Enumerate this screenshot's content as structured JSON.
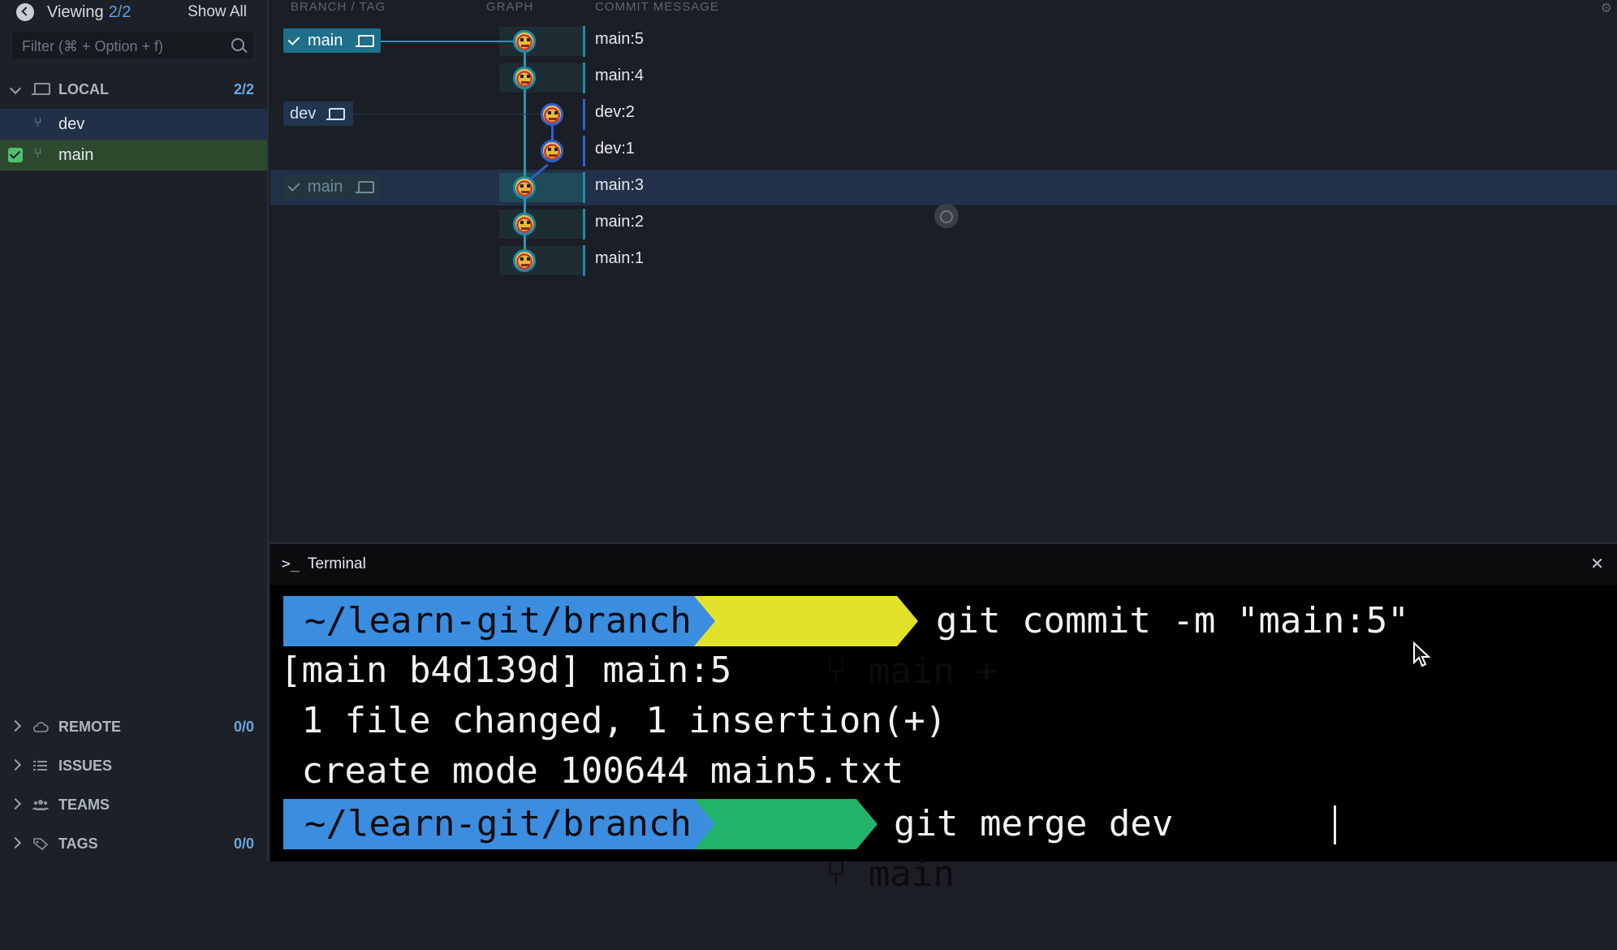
{
  "sidebar": {
    "viewing_label": "Viewing",
    "viewing_count": "2/2",
    "show_all": "Show All",
    "filter_placeholder": "Filter (⌘ + Option + f)",
    "local": {
      "label": "LOCAL",
      "count": "2/2"
    },
    "branches": [
      {
        "label": "dev",
        "checked": false
      },
      {
        "label": "main",
        "checked": true
      }
    ],
    "remote": {
      "label": "REMOTE",
      "count": "0/0"
    },
    "issues": {
      "label": "ISSUES"
    },
    "teams": {
      "label": "TEAMS"
    },
    "tags": {
      "label": "TAGS",
      "count": "0/0"
    }
  },
  "graph": {
    "col_branch": "BRANCH / TAG",
    "col_graph": "GRAPH",
    "col_message": "COMMIT MESSAGE",
    "settings_icon": "gear-icon",
    "tags": [
      {
        "label": "main",
        "row": 0,
        "checked": true,
        "style": "active"
      },
      {
        "label": "dev",
        "row": 2,
        "checked": false,
        "style": "branch"
      },
      {
        "label": "main",
        "row": 4,
        "checked": true,
        "style": "ghost"
      }
    ],
    "commits": [
      {
        "message": "main:5",
        "lane": "main"
      },
      {
        "message": "main:4",
        "lane": "main"
      },
      {
        "message": "dev:2",
        "lane": "dev"
      },
      {
        "message": "dev:1",
        "lane": "dev"
      },
      {
        "message": "main:3",
        "lane": "main",
        "selected": true
      },
      {
        "message": "main:2",
        "lane": "main"
      },
      {
        "message": "main:1",
        "lane": "main"
      }
    ]
  },
  "terminal": {
    "title": "Terminal",
    "prompt_glyph": ">_",
    "path": "~/learn-git/branch-demo",
    "prompt1_branch": "main +",
    "prompt1_cmd": "git commit -m \"main:5\"",
    "output": [
      "[main b4d139d] main:5",
      " 1 file changed, 1 insertion(+)",
      " create mode 100644 main5.txt"
    ],
    "prompt2_branch": "main",
    "prompt2_cmd": "git merge dev",
    "colors": {
      "path": "#3b8de0",
      "dirty": "#e3e22a",
      "clean": "#22b36a"
    }
  }
}
